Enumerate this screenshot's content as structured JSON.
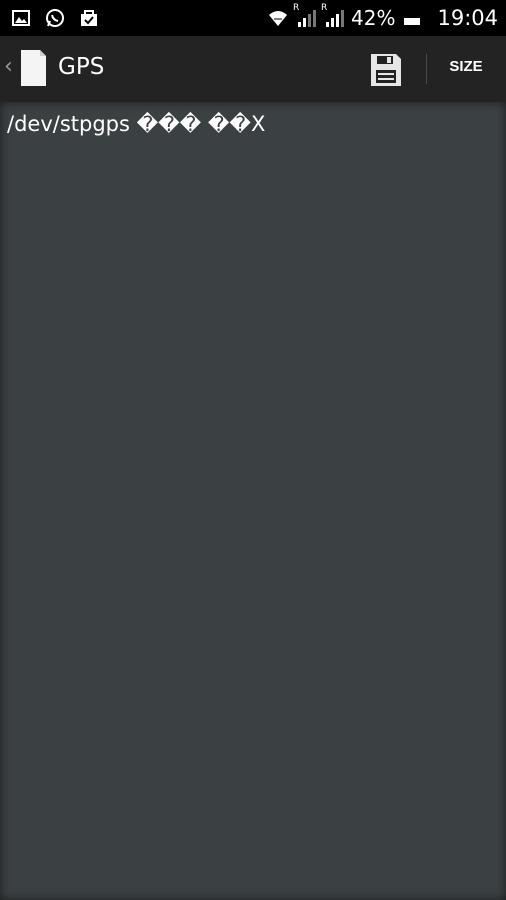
{
  "status_bar": {
    "icons_left": [
      "image-icon",
      "whatsapp-icon",
      "shopping-bag-icon"
    ],
    "icons_right": [
      "wifi-icon",
      "signal-icon",
      "signal-icon"
    ],
    "roaming_label": "R",
    "battery_percent": "42%",
    "time": "19:04"
  },
  "action_bar": {
    "up_chevron": "‹",
    "title": "GPS",
    "save_icon": "save-icon",
    "size_label": "SIZE"
  },
  "content": {
    "text": "/dev/stpgps ��� ��X"
  },
  "colors": {
    "action_bar_bg": "#232323",
    "content_bg": "#3b4042",
    "status_bar_bg": "#000000"
  }
}
